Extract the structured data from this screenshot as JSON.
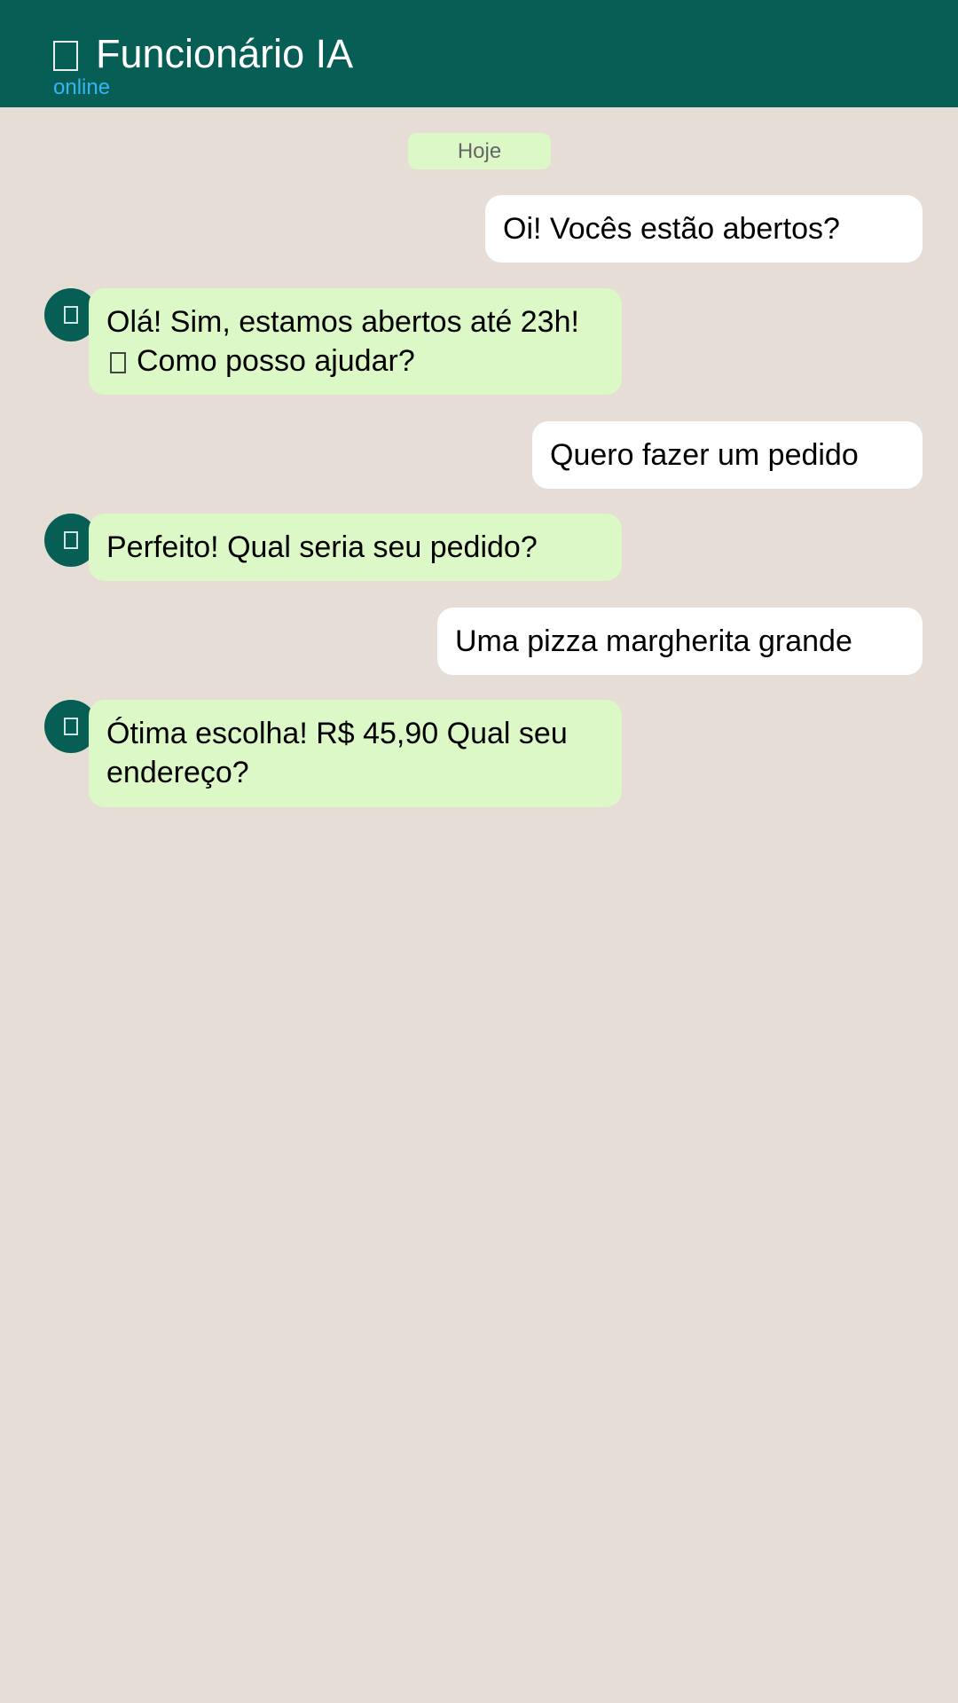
{
  "header": {
    "title": "Funcionário IA",
    "status": "online",
    "title_icon": "bot-icon"
  },
  "date_chip": "Hoje",
  "messages": [
    {
      "from": "user",
      "text": "Oi! Vocês estão abertos?"
    },
    {
      "from": "bot",
      "line1": "Olá! Sim, estamos abertos até 23h!",
      "line2": "Como posso ajudar?",
      "inline_icon": "emoji-icon"
    },
    {
      "from": "user",
      "text": "Quero fazer um pedido"
    },
    {
      "from": "bot",
      "text": "Perfeito! Qual seria seu pedido?"
    },
    {
      "from": "user",
      "text": "Uma pizza margherita grande"
    },
    {
      "from": "bot",
      "text": "Ótima escolha! R$ 45,90 Qual seu endereço?"
    }
  ],
  "colors": {
    "header_bg": "#075e54",
    "status": "#34b7f1",
    "chat_bg": "#e5ddd6",
    "bot_bubble": "#dcf8c6",
    "user_bubble": "#ffffff"
  }
}
